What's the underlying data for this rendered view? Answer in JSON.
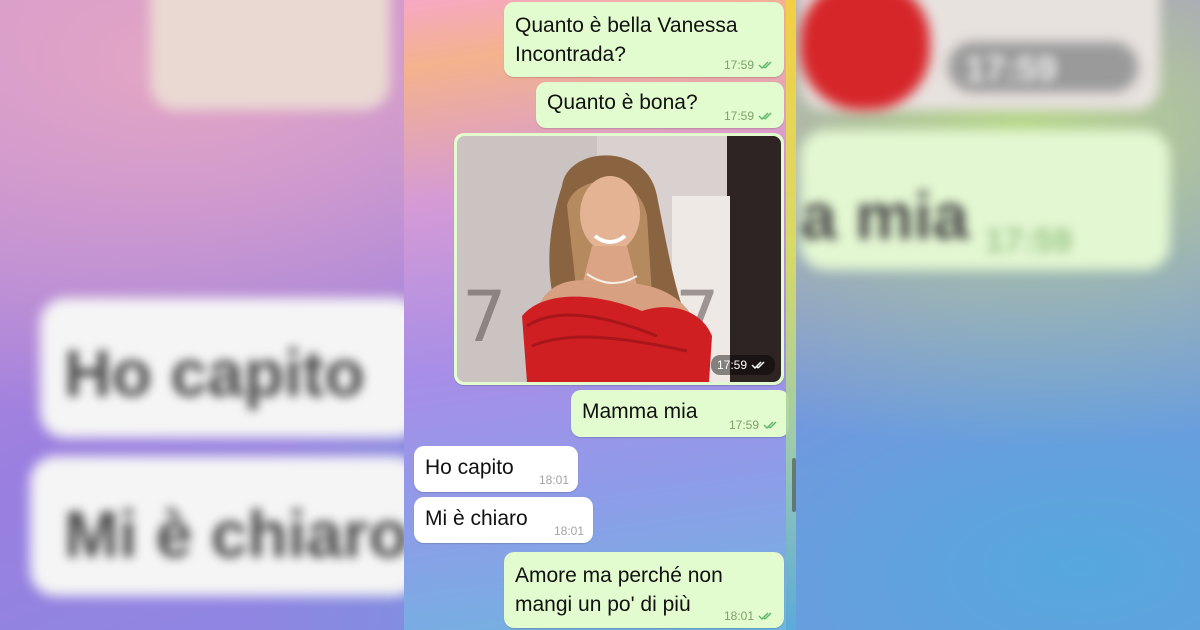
{
  "background_ghosts": {
    "left_top_time": "",
    "right_top_time": "17:59",
    "right_mid_text": "a mia",
    "right_mid_time": "17:59",
    "left_mid_text": "Ho capito",
    "left_low_text": "Mi è chiaro"
  },
  "messages": [
    {
      "kind": "outgoing",
      "text_lines": [
        "Quanto è bella Vanessa",
        "Incontrada?"
      ],
      "time": "17:59",
      "status": "read"
    },
    {
      "kind": "outgoing",
      "text_lines": [
        "Quanto è bona?"
      ],
      "time": "17:59",
      "status": "read"
    },
    {
      "kind": "outgoing-photo",
      "photo_subject": "woman in red dress",
      "time": "17:59",
      "status": "read"
    },
    {
      "kind": "outgoing",
      "text_lines": [
        "Mamma mia"
      ],
      "time": "17:59",
      "status": "read"
    },
    {
      "kind": "incoming",
      "text_lines": [
        "Ho capito"
      ],
      "time": "18:01"
    },
    {
      "kind": "incoming",
      "text_lines": [
        "Mi è chiaro"
      ],
      "time": "18:01"
    },
    {
      "kind": "outgoing",
      "text_lines": [
        "Amore ma perché non",
        "mangi un po' di più"
      ],
      "time": "18:01",
      "status": "read"
    }
  ],
  "colors": {
    "outgoing_bubble": "#e2fbcf",
    "incoming_bubble": "#ffffff",
    "read_tick": "#5fb86b"
  }
}
